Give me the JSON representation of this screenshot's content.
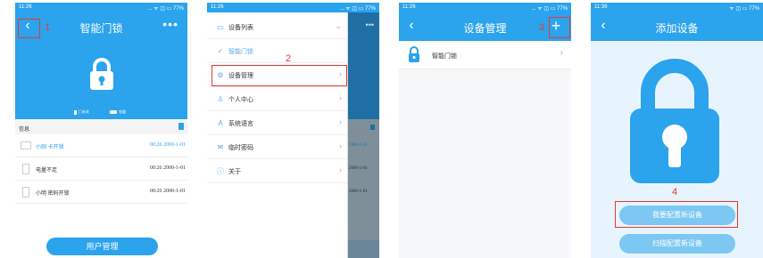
{
  "status": {
    "time1": "11:26",
    "time2": "11:26",
    "time3": "11:26",
    "time4": "11:36",
    "sys": "... ᯤ ◫ ▭ 77%",
    "sys4": "ᯤ ◫ ▭ 77%"
  },
  "screen1": {
    "title": "智能门锁",
    "step": "1",
    "legend_closed": "门未关",
    "legend_battery": "电量",
    "section": "信息",
    "logs": [
      {
        "name": "小刚 卡开锁",
        "time": "00:26 2000-1-01"
      },
      {
        "name": "电量不足",
        "time": "00:26 2000-1-01"
      },
      {
        "name": "小明 密码开锁",
        "time": "00:26 2000-1-01"
      }
    ],
    "user_btn": "用户管理"
  },
  "screen2": {
    "step": "2",
    "menu": [
      {
        "label": "设备列表",
        "icon": "monitor-icon",
        "glyph": "▭",
        "chev": "⌄"
      },
      {
        "label": "智能门锁",
        "icon": "check-icon",
        "glyph": "✓",
        "chev": ""
      },
      {
        "label": "设备管理",
        "icon": "gear-icon",
        "glyph": "⚙",
        "chev": "›"
      },
      {
        "label": "个人中心",
        "icon": "person-icon",
        "glyph": "♙",
        "chev": "›"
      },
      {
        "label": "系统语言",
        "icon": "language-icon",
        "glyph": "A",
        "chev": "›"
      },
      {
        "label": "临时密码",
        "icon": "mail-icon",
        "glyph": "✉",
        "chev": "›"
      },
      {
        "label": "关于",
        "icon": "info-icon",
        "glyph": "ⓘ",
        "chev": "›"
      }
    ],
    "bg_times": [
      "2000-1-01",
      "2000-1-01",
      "2000-1-01"
    ]
  },
  "screen3": {
    "title": "设备管理",
    "step": "3",
    "device": "智能门锁"
  },
  "screen4": {
    "title": "添加设备",
    "step": "4",
    "btn_reconfig": "我要配置新设备",
    "btn_scan": "扫描配置新设备"
  },
  "colors": {
    "brand": "#2ba3ed",
    "marker": "#e53935"
  }
}
